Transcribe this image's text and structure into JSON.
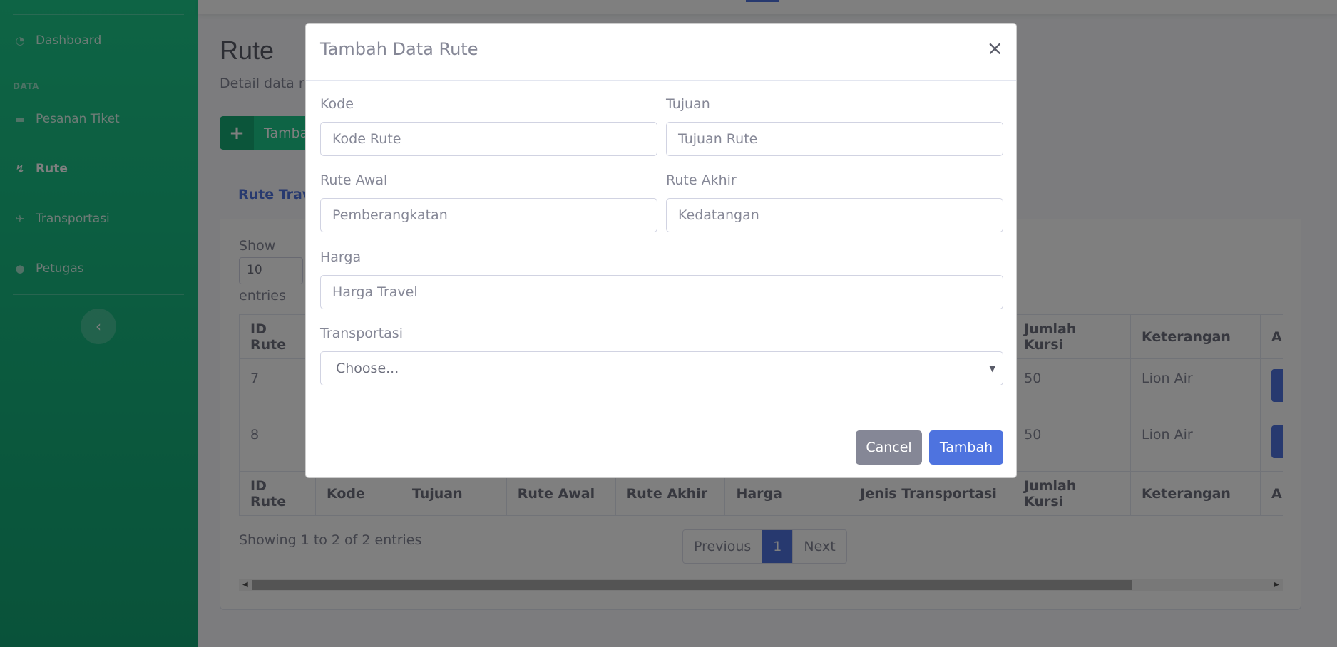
{
  "sidebar": {
    "items": [
      {
        "label": "Dashboard",
        "icon": "dashboard-icon"
      },
      {
        "label": "Pesanan Tiket",
        "icon": "ticket-icon"
      },
      {
        "label": "Rute",
        "icon": "route-icon"
      },
      {
        "label": "Transportasi",
        "icon": "plane-icon"
      },
      {
        "label": "Petugas",
        "icon": "user-icon"
      }
    ],
    "heading": "DATA",
    "toggle_icon": "chevron-left-icon"
  },
  "page": {
    "title": "Rute",
    "subtitle": "Detail data ru",
    "add_button_label": "Tamba"
  },
  "card": {
    "title": "Rute Trave",
    "show_label": "Show",
    "show_value": "10",
    "entries_label": "entries",
    "table": {
      "columns": [
        "ID Rute",
        "Kode",
        "Tujuan",
        "Rute Awal",
        "Rute Akhir",
        "Harga",
        "Jenis Transportasi",
        "Jumlah Kursi",
        "Keterangan",
        "Al"
      ],
      "rows": [
        {
          "id": "7",
          "jumlah_kursi": "50",
          "keterangan": "Lion Air"
        },
        {
          "id": "8",
          "jumlah_kursi": "50",
          "keterangan": "Lion Air"
        }
      ]
    },
    "showing_text": "Showing 1 to 2 of 2 entries",
    "pagination": {
      "previous": "Previous",
      "current": "1",
      "next": "Next"
    }
  },
  "modal": {
    "title": "Tambah Data Rute",
    "close_symbol": "×",
    "fields": {
      "kode": {
        "label": "Kode",
        "placeholder": "Kode Rute"
      },
      "tujuan": {
        "label": "Tujuan",
        "placeholder": "Tujuan Rute"
      },
      "rute_awal": {
        "label": "Rute Awal",
        "placeholder": "Pemberangkatan"
      },
      "rute_akhir": {
        "label": "Rute Akhir",
        "placeholder": "Kedatangan"
      },
      "harga": {
        "label": "Harga",
        "placeholder": "Harga Travel"
      },
      "transportasi": {
        "label": "Transportasi",
        "selected": "Choose..."
      }
    },
    "buttons": {
      "cancel": "Cancel",
      "submit": "Tambah"
    }
  },
  "colors": {
    "sidebar": "#1cc88a",
    "primary": "#4e73df",
    "secondary": "#858796"
  }
}
